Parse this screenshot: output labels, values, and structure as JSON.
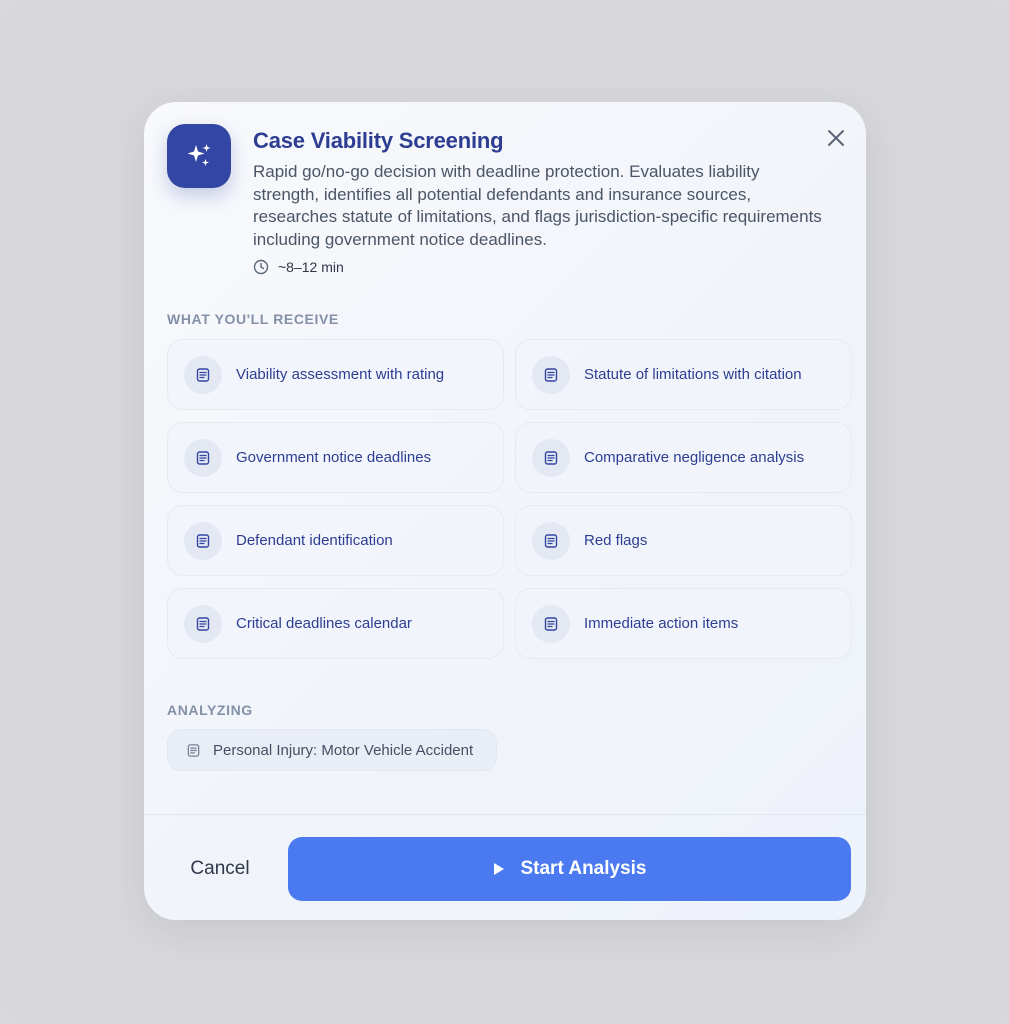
{
  "dialog": {
    "title": "Case Viability Screening",
    "description": "Rapid go/no-go decision with deadline protection. Evaluates liability strength, identifies all potential defendants and insurance sources, researches statute of limitations, and flags jurisdiction-specific requirements including government notice deadlines.",
    "duration": "~8–12 min",
    "icon": "sparkles-icon",
    "close_icon": "close-icon"
  },
  "receive": {
    "heading": "WHAT YOU'LL RECEIVE",
    "items": [
      {
        "label": "Viability assessment with rating",
        "icon": "document-icon"
      },
      {
        "label": "Statute of limitations with citation",
        "icon": "document-icon"
      },
      {
        "label": "Government notice deadlines",
        "icon": "document-icon"
      },
      {
        "label": "Comparative negligence analysis",
        "icon": "document-icon"
      },
      {
        "label": "Defendant identification",
        "icon": "document-icon"
      },
      {
        "label": "Red flags",
        "icon": "document-icon"
      },
      {
        "label": "Critical deadlines calendar",
        "icon": "document-icon"
      },
      {
        "label": "Immediate action items",
        "icon": "document-icon"
      }
    ]
  },
  "analyzing": {
    "heading": "ANALYZING",
    "case_label": "Personal Injury: Motor Vehicle Accident"
  },
  "footer": {
    "cancel_label": "Cancel",
    "start_label": "Start Analysis"
  },
  "colors": {
    "accent": "#4a79f0",
    "brand": "#3346a3",
    "title": "#2d3d91"
  }
}
